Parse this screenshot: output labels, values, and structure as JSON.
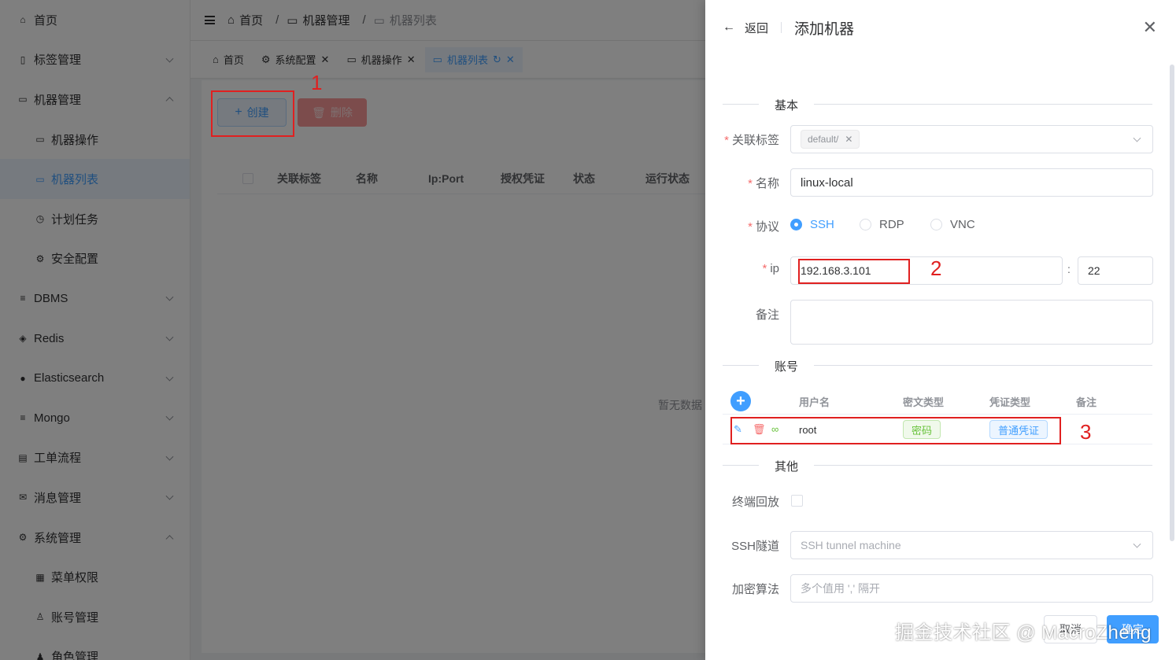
{
  "sidebar": {
    "items": [
      {
        "label": "首页",
        "icon": "home-icon",
        "sub": false,
        "arrow": ""
      },
      {
        "label": "标签管理",
        "icon": "bookmark-icon",
        "sub": false,
        "arrow": "down"
      },
      {
        "label": "机器管理",
        "icon": "monitor-icon",
        "sub": false,
        "arrow": "up"
      },
      {
        "label": "机器操作",
        "icon": "monitor-icon",
        "sub": true,
        "arrow": ""
      },
      {
        "label": "机器列表",
        "icon": "monitor-icon",
        "sub": true,
        "arrow": "",
        "active": true
      },
      {
        "label": "计划任务",
        "icon": "alarm-icon",
        "sub": true,
        "arrow": ""
      },
      {
        "label": "安全配置",
        "icon": "gear-icon",
        "sub": true,
        "arrow": ""
      },
      {
        "label": "DBMS",
        "icon": "database-icon",
        "sub": false,
        "arrow": "down"
      },
      {
        "label": "Redis",
        "icon": "layers-icon",
        "sub": false,
        "arrow": "down"
      },
      {
        "label": "Elasticsearch",
        "icon": "elastic-icon",
        "sub": false,
        "arrow": "down"
      },
      {
        "label": "Mongo",
        "icon": "database-icon",
        "sub": false,
        "arrow": "down"
      },
      {
        "label": "工单流程",
        "icon": "clipboard-icon",
        "sub": false,
        "arrow": "down"
      },
      {
        "label": "消息管理",
        "icon": "mail-icon",
        "sub": false,
        "arrow": "down"
      },
      {
        "label": "系统管理",
        "icon": "gear-icon",
        "sub": false,
        "arrow": "up"
      },
      {
        "label": "菜单权限",
        "icon": "grid-icon",
        "sub": true,
        "arrow": ""
      },
      {
        "label": "账号管理",
        "icon": "user-icon",
        "sub": true,
        "arrow": ""
      },
      {
        "label": "角色管理",
        "icon": "users-icon",
        "sub": true,
        "arrow": ""
      }
    ]
  },
  "breadcrumb": {
    "home": "首页",
    "parent": "机器管理",
    "current": "机器列表",
    "sep": "/"
  },
  "tabs": [
    {
      "label": "首页",
      "icon": "home-icon"
    },
    {
      "label": "系统配置",
      "icon": "gear-icon"
    },
    {
      "label": "机器操作",
      "icon": "monitor-icon"
    },
    {
      "label": "机器列表",
      "icon": "monitor-icon"
    }
  ],
  "toolbar": {
    "create_label": "创建",
    "delete_label": "删除"
  },
  "table": {
    "columns": [
      "关联标签",
      "名称",
      "Ip:Port",
      "授权凭证",
      "状态",
      "运行状态"
    ],
    "empty_text": "暂无数据"
  },
  "annotations": {
    "one": "1",
    "two": "2",
    "three": "3"
  },
  "drawer": {
    "back_label": "返回",
    "title": "添加机器",
    "sections": {
      "basic": "基本",
      "account": "账号",
      "other": "其他"
    },
    "fields": {
      "tag": {
        "label": "关联标签",
        "chip": "default/"
      },
      "name": {
        "label": "名称",
        "value": "linux-local"
      },
      "protocol": {
        "label": "协议",
        "options": [
          "SSH",
          "RDP",
          "VNC"
        ],
        "selected": "SSH"
      },
      "ip": {
        "label": "ip",
        "value": "192.168.3.101",
        "colon": ":",
        "port": "22"
      },
      "remark": {
        "label": "备注",
        "value": ""
      },
      "term_playback": {
        "label": "终端回放"
      },
      "ssh_tunnel": {
        "label": "SSH隧道",
        "placeholder": "SSH tunnel machine"
      },
      "cipher": {
        "label": "加密算法",
        "placeholder": "多个值用 ',' 隔开"
      }
    },
    "accounts": {
      "columns": [
        "用户名",
        "密文类型",
        "凭证类型",
        "备注"
      ],
      "rows": [
        {
          "username": "root",
          "cipher_type": "密码",
          "cred_type": "普通凭证",
          "remark": ""
        }
      ]
    },
    "footer": {
      "cancel": "取消",
      "confirm": "确定"
    }
  },
  "watermark": "掘金技术社区 @ MacroZheng",
  "colors": {
    "primary": "#409eff",
    "danger": "#f56c6c",
    "success": "#67c23a",
    "annotation": "#e02020"
  }
}
